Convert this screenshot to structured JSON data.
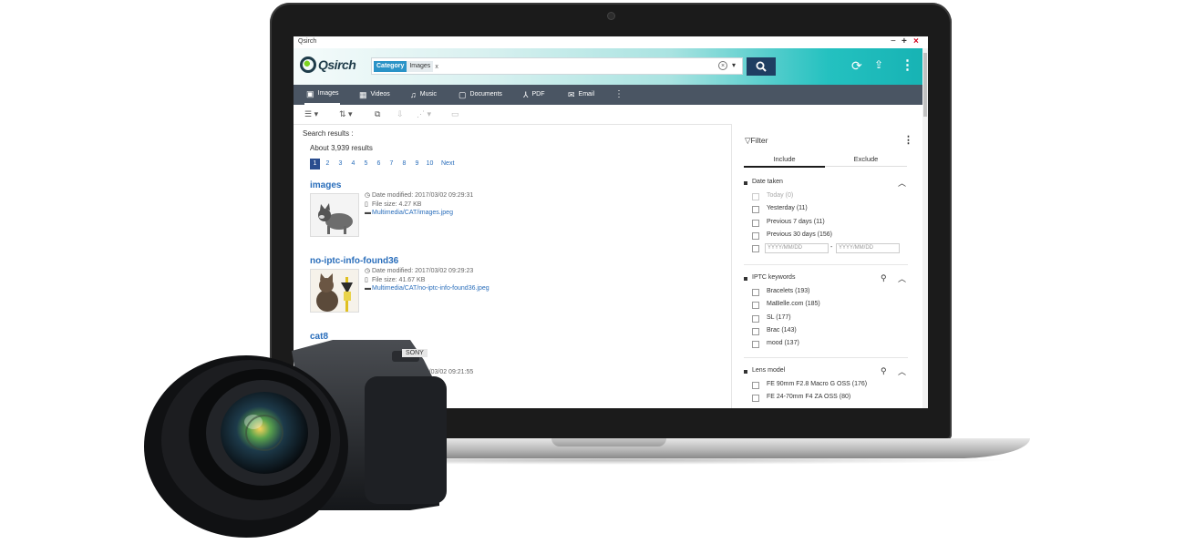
{
  "window": {
    "title": "Qsirch",
    "min": "−",
    "max": "+",
    "close": "×"
  },
  "header": {
    "logo_text": "Qsirch",
    "search": {
      "chip_category": "Category",
      "chip_value": "Images",
      "chip_remove": "x",
      "clear": "×",
      "dropdown": "▾"
    },
    "icons": {
      "search": "search-icon",
      "refresh": "refresh-icon",
      "upload": "upload-icon",
      "more": "more-icon"
    }
  },
  "categories": [
    {
      "label": "Images",
      "icon": "▣"
    },
    {
      "label": "Videos",
      "icon": "▦"
    },
    {
      "label": "Music",
      "icon": "♫"
    },
    {
      "label": "Documents",
      "icon": "▢"
    },
    {
      "label": "PDF",
      "icon": "⅄"
    },
    {
      "label": "Email",
      "icon": "✉"
    },
    {
      "label": "",
      "icon": "⋮"
    }
  ],
  "toolbar": {
    "list": "☰ ▾",
    "sort": "⇅ ▾",
    "select": "⧉",
    "download": "⇩",
    "share": "⋰ ▾",
    "folder": "▭"
  },
  "results": {
    "label": "Search results :",
    "count": "About 3,939 results",
    "pages": [
      "1",
      "2",
      "3",
      "4",
      "5",
      "6",
      "7",
      "8",
      "9",
      "10"
    ],
    "next": "Next",
    "items": [
      {
        "title": "images",
        "date": "Date modified: 2017/03/02 09:29:31",
        "size": "File size: 4.27 KB",
        "path": "Multimedia/CAT/images.jpeg"
      },
      {
        "title": "no-iptc-info-found36",
        "date": "Date modified: 2017/03/02 09:29:23",
        "size": "File size: 41.67 KB",
        "path": "Multimedia/CAT/no-iptc-info-found36.jpeg"
      },
      {
        "title": "cat8",
        "date": "Date modified: 2017/03/02 09:21:55",
        "size": "",
        "path": ""
      }
    ]
  },
  "filter": {
    "title": "Filter",
    "more": "⋮",
    "tabs": {
      "include": "Include",
      "exclude": "Exclude"
    },
    "date_taken": {
      "label": "Date taken",
      "options": [
        "Today  (0)",
        "Yesterday  (11)",
        "Previous 7 days  (11)",
        "Previous 30 days  (156)"
      ],
      "from_placeholder": "YYYY/MM/DD",
      "to_placeholder": "YYYY/MM/DD",
      "dash": "-"
    },
    "iptc": {
      "label": "IPTC keywords",
      "options": [
        "Bracelets  (193)",
        "MaBelle.com  (185)",
        "SL  (177)",
        "Brac  (143)",
        "mood  (137)"
      ]
    },
    "lens": {
      "label": "Lens model",
      "options": [
        "FE 90mm F2.8 Macro G OSS  (176)",
        "FE 24-70mm F4 ZA OSS  (80)"
      ]
    }
  },
  "camera": {
    "brand": "SONY"
  },
  "colors": {
    "accent": "#2a6ebb",
    "navbar": "#4a5563",
    "search_button": "#1f3e62",
    "teal": "#17b3b4"
  }
}
